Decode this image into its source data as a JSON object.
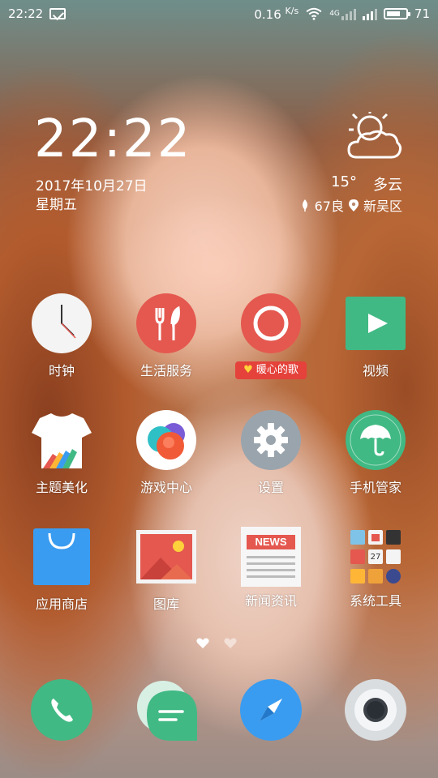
{
  "status_bar": {
    "time": "22:22",
    "network_speed": "0.16",
    "network_speed_unit": "K/s",
    "network_type": "4G",
    "battery": "71",
    "icons": [
      "message-icon",
      "wifi-icon",
      "signal-icon",
      "battery-icon"
    ]
  },
  "clock_widget": {
    "time": "22:22",
    "date": "2017年10月27日",
    "weekday": "星期五"
  },
  "weather_widget": {
    "icon": "partly-cloudy-icon",
    "temperature": "15°",
    "condition": "多云",
    "aqi": "67良",
    "location": "新吴区"
  },
  "apps": [
    {
      "label": "时钟",
      "icon": "clock-icon"
    },
    {
      "label": "生活服务",
      "icon": "fork-knife-icon"
    },
    {
      "label": "暖心的歌",
      "icon": "music-icon"
    },
    {
      "label": "视频",
      "icon": "play-icon"
    },
    {
      "label": "主题美化",
      "icon": "tshirt-icon"
    },
    {
      "label": "游戏中心",
      "icon": "game-center-icon"
    },
    {
      "label": "设置",
      "icon": "gear-icon"
    },
    {
      "label": "手机管家",
      "icon": "umbrella-icon"
    },
    {
      "label": "应用商店",
      "icon": "shopping-bag-icon"
    },
    {
      "label": "图库",
      "icon": "gallery-icon"
    },
    {
      "label": "新闻资讯",
      "icon": "news-icon"
    },
    {
      "label": "系统工具",
      "icon": "folder-icon"
    }
  ],
  "news_icon_text": "NEWS",
  "tool_folder_day": "27",
  "dock": [
    {
      "icon": "phone-icon"
    },
    {
      "icon": "message-bubble-icon"
    },
    {
      "icon": "browser-compass-icon"
    },
    {
      "icon": "camera-icon"
    }
  ],
  "colors": {
    "red_app": "#e4584f",
    "green_app": "#41b984",
    "gray_app": "#9aa4ad",
    "blue_app": "#3a9cf0"
  }
}
